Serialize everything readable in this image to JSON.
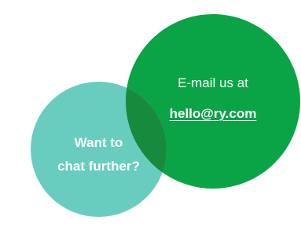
{
  "contact_bubble": {
    "line1": "E-mail us at",
    "email": "hello@ry.com",
    "color": "#0aa446"
  },
  "chat_bubble": {
    "line1": "Want to",
    "line2": "chat further?",
    "color": "#68cdbf"
  },
  "overlap_color": "#178a3e"
}
